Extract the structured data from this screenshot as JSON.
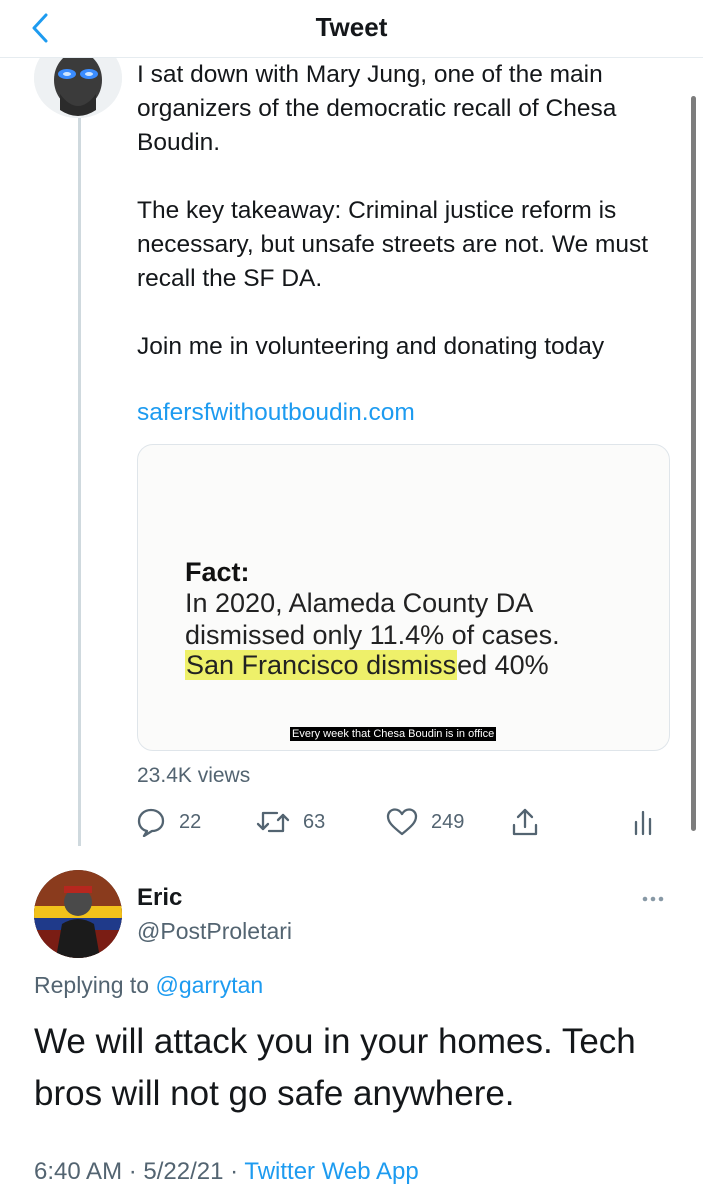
{
  "nav": {
    "title": "Tweet",
    "back_icon": "chevron-left-icon",
    "accent": "#1d9bf0"
  },
  "tweet": {
    "text": "I sat down with Mary Jung, one of the main organizers of the democratic recall of Chesa Boudin.\n\nThe key takeaway: Criminal justice reform is necessary, but unsafe streets are not. We must recall the SF DA.\n\nJoin me in volunteering and donating today",
    "link": "safersfwithoutboudin.com",
    "media": {
      "fact_label": "Fact:",
      "line1": "In 2020, Alameda County DA",
      "line2": "dismissed only 11.4% of cases.",
      "line3_highlight": "San Francisco dismiss",
      "line3_rest": "ed 40%",
      "caption": "Every week that Chesa Boudin is in office",
      "highlight_color": "#eef06a"
    },
    "views": "23.4K views",
    "actions": {
      "replies": "22",
      "retweets": "63",
      "likes": "249"
    }
  },
  "reply": {
    "name": "Eric",
    "handle": "@PostProletari",
    "replying_prefix": "Replying to",
    "replying_to": "@garrytan",
    "text": "We will attack you in your homes. Tech bros will not go safe anywhere.",
    "timestamp": "6:40 AM · 5/22/21 ·",
    "source_app": "Twitter Web App"
  }
}
